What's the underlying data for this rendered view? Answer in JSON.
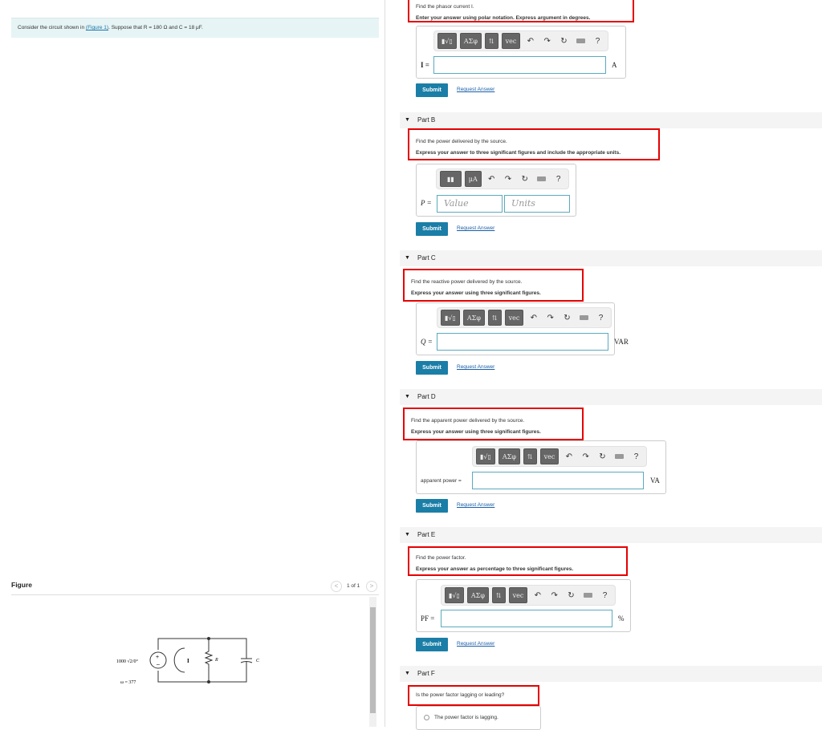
{
  "intro": {
    "prefix": "Consider the circuit shown in ",
    "link": "(Figure 1)",
    "suffix": ". Suppose that R = 180 Ω and C = 18 μF."
  },
  "figure": {
    "title": "Figure",
    "pager": "1 of 1",
    "prev_icon": "chevron-left-icon",
    "next_icon": "chevron-right-icon",
    "circuit": {
      "source": "1000 √2/0°",
      "omega": "ω = 377",
      "current": "I",
      "R": "R",
      "C": "C"
    }
  },
  "toolbar": {
    "templates": "▮√▯",
    "greek": "ΑΣφ",
    "arrows": "⇅",
    "vec": "vec",
    "units": "μA",
    "help": "?",
    "undo_icon": "undo-icon",
    "redo_icon": "redo-icon",
    "reset_icon": "reset-icon",
    "keyboard_icon": "keyboard-icon"
  },
  "common": {
    "submit": "Submit",
    "request": "Request Answer"
  },
  "partA": {
    "line1": "Find the phasor current I.",
    "line2": "Enter your answer using polar notation. Express argument in degrees.",
    "label": "I =",
    "unit": "A",
    "value": ""
  },
  "partB": {
    "header": "Part B",
    "line1": "Find the power delivered by the source.",
    "line2": "Express your answer to three significant figures and include the appropriate units.",
    "label": "P =",
    "value_placeholder": "Value",
    "units_placeholder": "Units"
  },
  "partC": {
    "header": "Part C",
    "line1": "Find the reactive power delivered by the source.",
    "line2": "Express your answer using three significant figures.",
    "label": "Q =",
    "unit": "VAR"
  },
  "partD": {
    "header": "Part D",
    "line1": "Find the apparent power delivered by the source.",
    "line2": "Express your answer using three significant figures.",
    "label": "apparent power =",
    "unit": "VA"
  },
  "partE": {
    "header": "Part E",
    "line1": "Find the power factor.",
    "line2": "Express your answer as percentage to three significant figures.",
    "label": "PF =",
    "unit": "%"
  },
  "partF": {
    "header": "Part F",
    "line1": "Is the power factor lagging or leading?",
    "option1": "The power factor is lagging."
  },
  "colors": {
    "accent": "#1a7ea7",
    "highlight": "#e60000",
    "intro_bg": "#e6f4f5"
  }
}
